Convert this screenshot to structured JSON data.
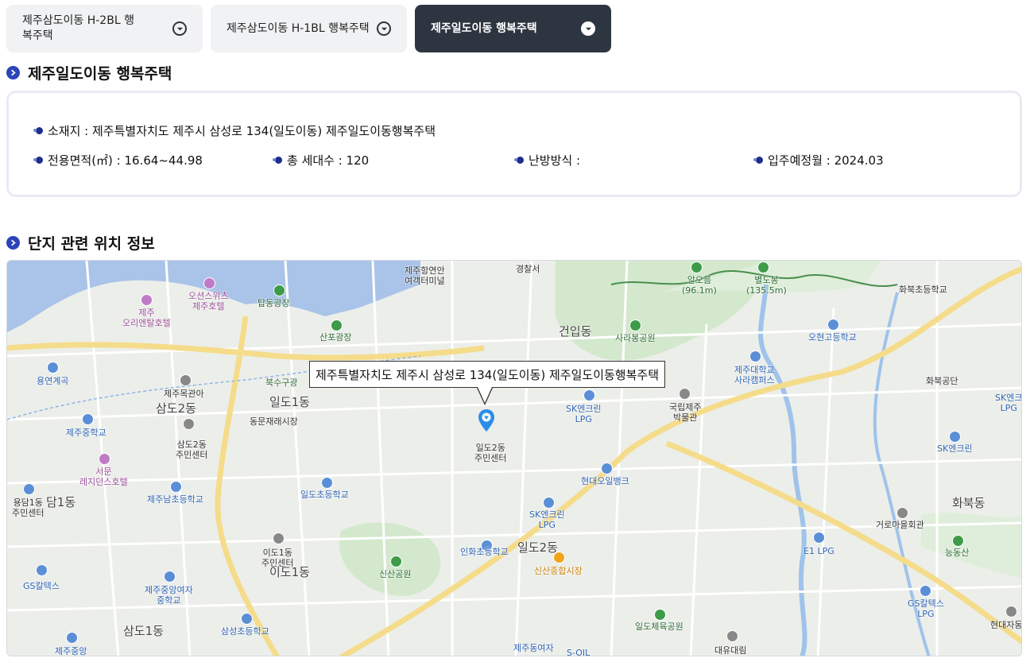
{
  "tabs": [
    {
      "label": "제주삼도이동 H-2BL 행복주택",
      "active": false
    },
    {
      "label": "제주삼도이동 H-1BL 행복주택",
      "active": false
    },
    {
      "label": "제주일도이동 행복주택",
      "active": true
    }
  ],
  "complex": {
    "title": "제주일도이동 행복주택",
    "address": "소재지 : 제주특별자치도 제주시 삼성로 134(일도이동) 제주일도이동행복주택",
    "area": "전용면적(㎡) : 16.64~44.98",
    "households": "총 세대수 : 120",
    "heating": "난방방식 :",
    "move_in": "입주예정월 : 2024.03"
  },
  "location": {
    "title": "단지 관련 위치 정보",
    "tooltip": "제주특별자치도 제주시 삼성로 134(일도이동) 제주일도이동행복주택"
  },
  "map_labels": {
    "l1": "제주항연안\n여객터미널",
    "l2": "경찰서",
    "l3": "오션스위츠\n제주호텔",
    "l4": "제주\n오리엔탈호텔",
    "l5": "탑동광장",
    "l6": "산포광장",
    "l7": "건입동",
    "l8": "사라봉공원",
    "l9": "알오름\n(96.1m)",
    "l10": "별도봉\n(135.5m)",
    "l11": "화북초등학교",
    "l12": "오현고등학교",
    "l13": "제주대학교\n사라캠퍼스",
    "l14": "용연계곡",
    "l15": "제주목관아",
    "l16": "북수구광",
    "l17": "일도1동",
    "l18": "동문재래시장",
    "l19": "삼도2동",
    "l20": "제주중학교",
    "l21": "삼도2동\n주민센터",
    "l22": "서문\n레지던스호텔",
    "l23": "제주남초등학교",
    "l24": "일도2동\n주민센터",
    "l25": "SK엔크린\nLPG",
    "l26": "국립제주\n박물관",
    "l27": "화북공단",
    "l28": "SK엔크\nLPG",
    "l29": "SK엔크린",
    "l30": "현대오일뱅크",
    "l31": "일도초등학교",
    "l32": "용담1동\n주민센터",
    "l33": "담1동",
    "l34": "SK엔크린\nLPG",
    "l35": "화북동",
    "l36": "거로마을회관",
    "l37": "이도1동\n주민센터",
    "l38": "이도1동",
    "l39": "인화초등학교",
    "l40": "일도2동",
    "l41": "신산종합시장",
    "l42": "신산공원",
    "l43": "E1 LPG",
    "l44": "능동산",
    "l45": "GS칼텍스",
    "l46": "제주중앙여자\n중학교",
    "l47": "GS칼텍스\nLPG",
    "l48": "현대자동",
    "l49": "삼도1동",
    "l50": "삼성초등학교",
    "l51": "일도체육공원",
    "l52": "제주중앙",
    "l53": "제주동여자",
    "l54": "S-OIL",
    "l55": "대유대림"
  }
}
